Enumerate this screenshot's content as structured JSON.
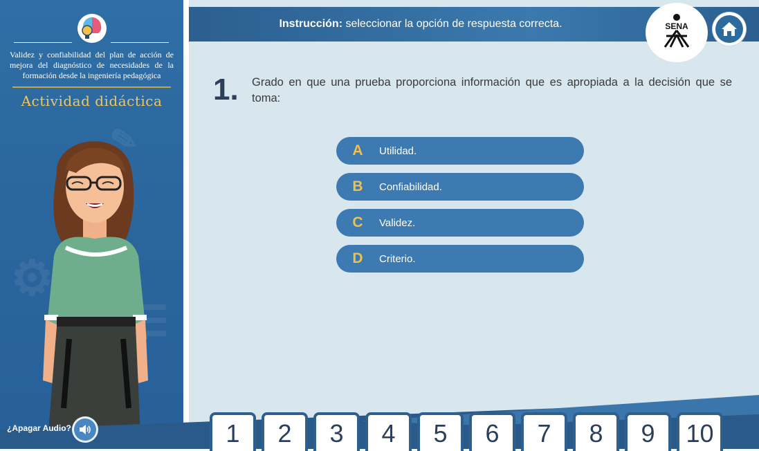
{
  "sidebar": {
    "title": "Validez y confiabilidad del plan de acción de mejora del diagnóstico de necesidades de la formación desde la ingeniería pedagógica",
    "subtitle": "Actividad didáctica",
    "audio_label": "¿Apagar Audio?"
  },
  "header": {
    "instruction_bold": "Instrucción:",
    "instruction_text": " seleccionar la opción de respuesta correcta.",
    "logo_text": "SENA"
  },
  "question": {
    "number": "1.",
    "text": "Grado en que una prueba proporciona información que es apropiada a la decisión que se toma:"
  },
  "options": [
    {
      "letter": "A",
      "label": "Utilidad."
    },
    {
      "letter": "B",
      "label": "Confiabilidad."
    },
    {
      "letter": "C",
      "label": "Validez."
    },
    {
      "letter": "D",
      "label": "Criterio."
    }
  ],
  "pagination": [
    "1",
    "2",
    "3",
    "4",
    "5",
    "6",
    "7",
    "8",
    "9",
    "10"
  ],
  "colors": {
    "accent": "#3d7ab2",
    "option_letter": "#f0c04a",
    "sidebar": "#2f6ea6",
    "background": "#d8e6ee"
  }
}
